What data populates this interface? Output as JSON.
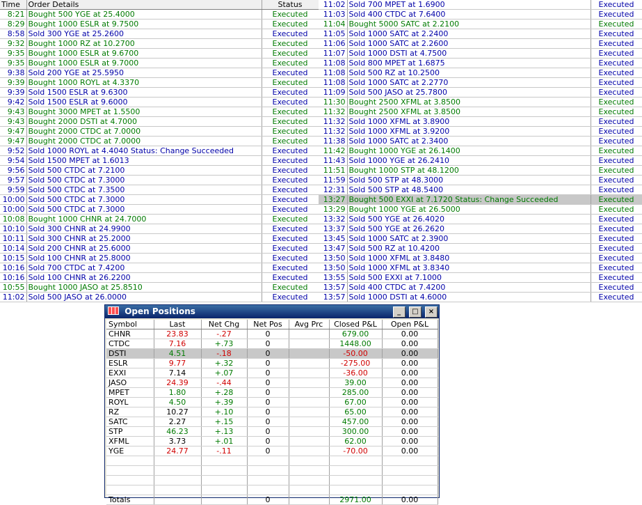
{
  "orders_header": {
    "time": "Time",
    "details": "Order Details",
    "status": "Status"
  },
  "left_orders": [
    {
      "time": "8:21",
      "details": "Bought 500 YGE at 25.4000",
      "status": "Executed",
      "side": "buy"
    },
    {
      "time": "8:29",
      "details": "Bought 1000 ESLR at 9.7500",
      "status": "Executed",
      "side": "buy"
    },
    {
      "time": "8:58",
      "details": "Sold 300 YGE at 25.2600",
      "status": "Executed",
      "side": "sell"
    },
    {
      "time": "9:32",
      "details": "Bought 1000 RZ at 10.2700",
      "status": "Executed",
      "side": "buy"
    },
    {
      "time": "9:35",
      "details": "Bought 1000 ESLR at 9.6700",
      "status": "Executed",
      "side": "buy"
    },
    {
      "time": "9:35",
      "details": "Bought 1000 ESLR at 9.7000",
      "status": "Executed",
      "side": "buy"
    },
    {
      "time": "9:38",
      "details": "Sold 200 YGE at 25.5950",
      "status": "Executed",
      "side": "sell"
    },
    {
      "time": "9:39",
      "details": "Bought 1000 ROYL at 4.3370",
      "status": "Executed",
      "side": "buy"
    },
    {
      "time": "9:39",
      "details": "Sold 1500 ESLR at 9.6300",
      "status": "Executed",
      "side": "sell"
    },
    {
      "time": "9:42",
      "details": "Sold 1500 ESLR at 9.6000",
      "status": "Executed",
      "side": "sell"
    },
    {
      "time": "9:43",
      "details": "Bought 3000 MPET at 1.5500",
      "status": "Executed",
      "side": "buy"
    },
    {
      "time": "9:43",
      "details": "Bought 2000 DSTI at 4.7000",
      "status": "Executed",
      "side": "buy"
    },
    {
      "time": "9:47",
      "details": "Bought 2000 CTDC at 7.0000",
      "status": "Executed",
      "side": "buy"
    },
    {
      "time": "9:47",
      "details": "Bought 2000 CTDC at 7.0000",
      "status": "Executed",
      "side": "buy"
    },
    {
      "time": "9:52",
      "details": "Sold 1000 ROYL at 4.4040 Status: Change Succeeded",
      "status": "Executed",
      "side": "sell"
    },
    {
      "time": "9:54",
      "details": "Sold 1500 MPET at 1.6013",
      "status": "Executed",
      "side": "sell"
    },
    {
      "time": "9:56",
      "details": "Sold 500 CTDC at 7.2100",
      "status": "Executed",
      "side": "sell"
    },
    {
      "time": "9:57",
      "details": "Sold 500 CTDC at 7.3000",
      "status": "Executed",
      "side": "sell"
    },
    {
      "time": "9:59",
      "details": "Sold 500 CTDC at 7.3500",
      "status": "Executed",
      "side": "sell"
    },
    {
      "time": "10:00",
      "details": "Sold 500 CTDC at 7.3000",
      "status": "Executed",
      "side": "sell"
    },
    {
      "time": "10:00",
      "details": "Sold 500 CTDC at 7.3000",
      "status": "Executed",
      "side": "sell"
    },
    {
      "time": "10:08",
      "details": "Bought 1000 CHNR at 24.7000",
      "status": "Executed",
      "side": "buy"
    },
    {
      "time": "10:10",
      "details": "Sold 300 CHNR at 24.9900",
      "status": "Executed",
      "side": "sell"
    },
    {
      "time": "10:11",
      "details": "Sold 300 CHNR at 25.2000",
      "status": "Executed",
      "side": "sell"
    },
    {
      "time": "10:14",
      "details": "Sold 200 CHNR at 25.6000",
      "status": "Executed",
      "side": "sell"
    },
    {
      "time": "10:15",
      "details": "Sold 100 CHNR at 25.8000",
      "status": "Executed",
      "side": "sell"
    },
    {
      "time": "10:16",
      "details": "Sold 700 CTDC at 7.4200",
      "status": "Executed",
      "side": "sell"
    },
    {
      "time": "10:16",
      "details": "Sold 100 CHNR at 26.2200",
      "status": "Executed",
      "side": "sell"
    },
    {
      "time": "10:55",
      "details": "Bought 1000 JASO at 25.8510",
      "status": "Executed",
      "side": "buy"
    },
    {
      "time": "11:02",
      "details": "Sold 500 JASO at 26.0000",
      "status": "Executed",
      "side": "sell"
    }
  ],
  "right_orders": [
    {
      "time": "11:02",
      "details": "Sold 700 MPET at 1.6900",
      "status": "Executed",
      "side": "sell"
    },
    {
      "time": "11:03",
      "details": "Sold 400 CTDC at 7.6400",
      "status": "Executed",
      "side": "sell"
    },
    {
      "time": "11:04",
      "details": "Bought 5000 SATC at 2.2100",
      "status": "Executed",
      "side": "buy"
    },
    {
      "time": "11:05",
      "details": "Sold 1000 SATC at 2.2400",
      "status": "Executed",
      "side": "sell"
    },
    {
      "time": "11:06",
      "details": "Sold 1000 SATC at 2.2600",
      "status": "Executed",
      "side": "sell"
    },
    {
      "time": "11:07",
      "details": "Sold 1000 DSTI at 4.7500",
      "status": "Executed",
      "side": "sell"
    },
    {
      "time": "11:08",
      "details": "Sold 800 MPET at 1.6875",
      "status": "Executed",
      "side": "sell"
    },
    {
      "time": "11:08",
      "details": "Sold 500 RZ at 10.2500",
      "status": "Executed",
      "side": "sell"
    },
    {
      "time": "11:08",
      "details": "Sold 1000 SATC at 2.2770",
      "status": "Executed",
      "side": "sell"
    },
    {
      "time": "11:09",
      "details": "Sold 500 JASO at 25.7800",
      "status": "Executed",
      "side": "sell"
    },
    {
      "time": "11:30",
      "details": "Bought 2500 XFML at 3.8500",
      "status": "Executed",
      "side": "buy"
    },
    {
      "time": "11:32",
      "details": "Bought 2500 XFML at 3.8500",
      "status": "Executed",
      "side": "buy"
    },
    {
      "time": "11:32",
      "details": "Sold 1000 XFML at 3.8900",
      "status": "Executed",
      "side": "sell"
    },
    {
      "time": "11:32",
      "details": "Sold 1000 XFML at 3.9200",
      "status": "Executed",
      "side": "sell"
    },
    {
      "time": "11:38",
      "details": "Sold 1000 SATC at 2.3400",
      "status": "Executed",
      "side": "sell"
    },
    {
      "time": "11:42",
      "details": "Bought 1000 YGE at 26.1400",
      "status": "Executed",
      "side": "buy"
    },
    {
      "time": "11:43",
      "details": "Sold 1000 YGE at 26.2410",
      "status": "Executed",
      "side": "sell"
    },
    {
      "time": "11:51",
      "details": "Bought 1000 STP at 48.1200",
      "status": "Executed",
      "side": "buy"
    },
    {
      "time": "11:59",
      "details": "Sold 500 STP at 48.3000",
      "status": "Executed",
      "side": "sell"
    },
    {
      "time": "12:31",
      "details": "Sold 500 STP at 48.5400",
      "status": "Executed",
      "side": "sell"
    },
    {
      "time": "13:27",
      "details": "Bought 500 EXXI at 7.1720 Status: Change Succeeded",
      "status": "Executed",
      "side": "buy",
      "highlight": true
    },
    {
      "time": "13:29",
      "details": "Bought 1000 YGE at 26.5000",
      "status": "Executed",
      "side": "buy"
    },
    {
      "time": "13:32",
      "details": "Sold 500 YGE at 26.4020",
      "status": "Executed",
      "side": "sell"
    },
    {
      "time": "13:37",
      "details": "Sold 500 YGE at 26.2620",
      "status": "Executed",
      "side": "sell"
    },
    {
      "time": "13:45",
      "details": "Sold 1000 SATC at 2.3900",
      "status": "Executed",
      "side": "sell"
    },
    {
      "time": "13:47",
      "details": "Sold 500 RZ at 10.4200",
      "status": "Executed",
      "side": "sell"
    },
    {
      "time": "13:50",
      "details": "Sold 1000 XFML at 3.8480",
      "status": "Executed",
      "side": "sell"
    },
    {
      "time": "13:50",
      "details": "Sold 1000 XFML at 3.8340",
      "status": "Executed",
      "side": "sell"
    },
    {
      "time": "13:55",
      "details": "Sold 500 EXXI at 7.1000",
      "status": "Executed",
      "side": "sell"
    },
    {
      "time": "13:57",
      "details": "Sold 400 CTDC at 7.4200",
      "status": "Executed",
      "side": "sell"
    },
    {
      "time": "13:57",
      "details": "Sold 1000 DSTI at 4.6000",
      "status": "Executed",
      "side": "sell"
    }
  ],
  "positions_window": {
    "title": "Open Positions",
    "columns": [
      "Symbol",
      "Last",
      "Net Chg",
      "Net Pos",
      "Avg Prc",
      "Closed P&L",
      "Open P&L"
    ],
    "rows": [
      {
        "symbol": "CHNR",
        "last": "23.83",
        "last_dir": "down",
        "net_chg": "-.27",
        "chg_dir": "down",
        "net_pos": "0",
        "avg_prc": "",
        "closed_pl": "679.00",
        "pl_dir": "up",
        "open_pl": "0.00"
      },
      {
        "symbol": "CTDC",
        "last": "7.16",
        "last_dir": "down",
        "net_chg": "+.73",
        "chg_dir": "up",
        "net_pos": "0",
        "avg_prc": "",
        "closed_pl": "1448.00",
        "pl_dir": "up",
        "open_pl": "0.00"
      },
      {
        "symbol": "DSTI",
        "last": "4.51",
        "last_dir": "up",
        "net_chg": "-.18",
        "chg_dir": "down",
        "net_pos": "0",
        "avg_prc": "",
        "closed_pl": "-50.00",
        "pl_dir": "down",
        "open_pl": "0.00",
        "selected": true
      },
      {
        "symbol": "ESLR",
        "last": "9.77",
        "last_dir": "down",
        "net_chg": "+.32",
        "chg_dir": "up",
        "net_pos": "0",
        "avg_prc": "",
        "closed_pl": "-275.00",
        "pl_dir": "down",
        "open_pl": "0.00"
      },
      {
        "symbol": "EXXI",
        "last": "7.14",
        "last_dir": "flat",
        "net_chg": "+.07",
        "chg_dir": "up",
        "net_pos": "0",
        "avg_prc": "",
        "closed_pl": "-36.00",
        "pl_dir": "down",
        "open_pl": "0.00"
      },
      {
        "symbol": "JASO",
        "last": "24.39",
        "last_dir": "down",
        "net_chg": "-.44",
        "chg_dir": "down",
        "net_pos": "0",
        "avg_prc": "",
        "closed_pl": "39.00",
        "pl_dir": "up",
        "open_pl": "0.00"
      },
      {
        "symbol": "MPET",
        "last": "1.80",
        "last_dir": "up",
        "net_chg": "+.28",
        "chg_dir": "up",
        "net_pos": "0",
        "avg_prc": "",
        "closed_pl": "285.00",
        "pl_dir": "up",
        "open_pl": "0.00"
      },
      {
        "symbol": "ROYL",
        "last": "4.50",
        "last_dir": "up",
        "net_chg": "+.39",
        "chg_dir": "up",
        "net_pos": "0",
        "avg_prc": "",
        "closed_pl": "67.00",
        "pl_dir": "up",
        "open_pl": "0.00"
      },
      {
        "symbol": "RZ",
        "last": "10.27",
        "last_dir": "flat",
        "net_chg": "+.10",
        "chg_dir": "up",
        "net_pos": "0",
        "avg_prc": "",
        "closed_pl": "65.00",
        "pl_dir": "up",
        "open_pl": "0.00"
      },
      {
        "symbol": "SATC",
        "last": "2.27",
        "last_dir": "flat",
        "net_chg": "+.15",
        "chg_dir": "up",
        "net_pos": "0",
        "avg_prc": "",
        "closed_pl": "457.00",
        "pl_dir": "up",
        "open_pl": "0.00"
      },
      {
        "symbol": "STP",
        "last": "46.23",
        "last_dir": "up",
        "net_chg": "+.13",
        "chg_dir": "up",
        "net_pos": "0",
        "avg_prc": "",
        "closed_pl": "300.00",
        "pl_dir": "up",
        "open_pl": "0.00"
      },
      {
        "symbol": "XFML",
        "last": "3.73",
        "last_dir": "flat",
        "net_chg": "+.01",
        "chg_dir": "up",
        "net_pos": "0",
        "avg_prc": "",
        "closed_pl": "62.00",
        "pl_dir": "up",
        "open_pl": "0.00"
      },
      {
        "symbol": "YGE",
        "last": "24.77",
        "last_dir": "down",
        "net_chg": "-.11",
        "chg_dir": "down",
        "net_pos": "0",
        "avg_prc": "",
        "closed_pl": "-70.00",
        "pl_dir": "down",
        "open_pl": "0.00"
      }
    ],
    "totals": {
      "label": "Totals",
      "net_pos": "0",
      "closed_pl": "2971.00",
      "open_pl": "0.00"
    }
  },
  "colors": {
    "buy": "#007a00",
    "sell": "#0000a8",
    "down": "#d00000",
    "titlebar": "#0a246a"
  }
}
